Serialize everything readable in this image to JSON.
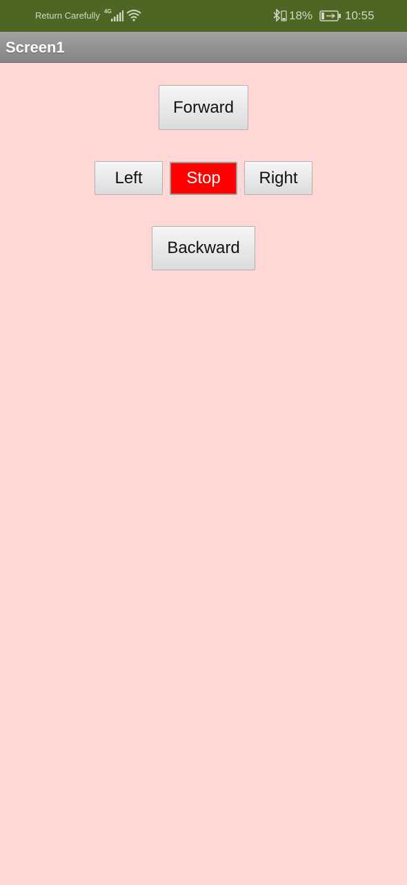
{
  "status_bar": {
    "carrier": "Return Carefully",
    "network_type": "4G",
    "battery_percent": "18%",
    "time": "10:55",
    "icons": [
      "signal-icon",
      "wifi-icon",
      "bluetooth-icon",
      "battery-icon"
    ]
  },
  "app": {
    "title": "Screen1",
    "background_color": "#ffd8d6",
    "title_bar_color": "#909090"
  },
  "controls": {
    "forward_label": "Forward",
    "left_label": "Left",
    "stop_label": "Stop",
    "right_label": "Right",
    "backward_label": "Backward",
    "stop_color": "#ff0000"
  }
}
